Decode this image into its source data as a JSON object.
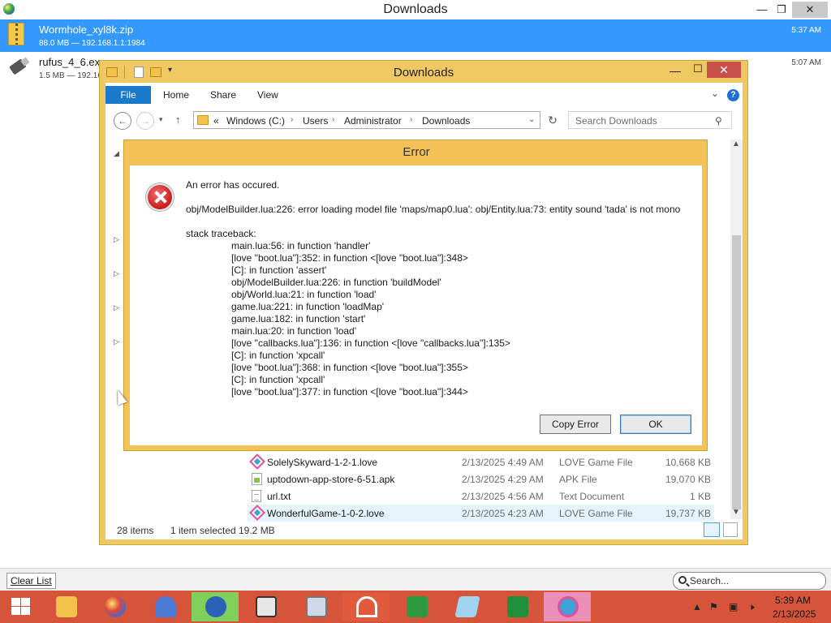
{
  "downloads_window": {
    "title": "Downloads",
    "minimize": "—",
    "maximize": "❐",
    "close": "✕",
    "items": [
      {
        "name": "Wormhole_xyl8k.zip",
        "meta": "88.0 MB — 192.168.1.1:1984",
        "time": "5:37 AM",
        "icon": "zip-folder-icon",
        "selected": true
      },
      {
        "name": "rufus_4_6.exe",
        "meta": "1.5 MB — 192.16",
        "time": "5:07 AM",
        "icon": "usb-drive-icon",
        "selected": false
      }
    ],
    "clear_list": "Clear List",
    "search_placeholder": "Search..."
  },
  "explorer": {
    "title": "Downloads",
    "ribbon": {
      "file": "File",
      "tabs": [
        "Home",
        "Share",
        "View"
      ],
      "help": "?"
    },
    "address": {
      "prefix": "«",
      "crumbs": [
        "Windows (C:)",
        "Users",
        "Administrator",
        "Downloads"
      ]
    },
    "search_placeholder": "Search Downloads",
    "files": [
      {
        "name": "SolelySkyward-1-2-1.love",
        "date": "2/13/2025 4:49 AM",
        "type": "LOVE Game File",
        "size": "10,668 KB",
        "icon": "love-file-icon"
      },
      {
        "name": "uptodown-app-store-6-51.apk",
        "date": "2/13/2025 4:29 AM",
        "type": "APK File",
        "size": "19,070 KB",
        "icon": "apk-file-icon"
      },
      {
        "name": "url.txt",
        "date": "2/13/2025 4:56 AM",
        "type": "Text Document",
        "size": "1 KB",
        "icon": "text-file-icon"
      },
      {
        "name": "WonderfulGame-1-0-2.love",
        "date": "2/13/2025 4:23 AM",
        "type": "LOVE Game File",
        "size": "19,737 KB",
        "icon": "love-file-icon"
      }
    ],
    "status": {
      "count": "28 items",
      "selected": "1 item selected",
      "size": "19.2 MB"
    }
  },
  "error_dialog": {
    "title": "Error",
    "heading": "An error has occured.",
    "message": "obj/ModelBuilder.lua:226: error loading model file 'maps/map0.lua': obj/Entity.lua:73: entity sound 'tada' is not mono",
    "traceback_label": "stack traceback:",
    "traceback": [
      "main.lua:56: in function 'handler'",
      "[love \"boot.lua\"]:352: in function <[love \"boot.lua\"]:348>",
      "[C]: in function 'assert'",
      "obj/ModelBuilder.lua:226: in function 'buildModel'",
      "obj/World.lua:21: in function 'load'",
      "game.lua:221: in function 'loadMap'",
      "game.lua:182: in function 'start'",
      "main.lua:20: in function 'load'",
      "[love \"callbacks.lua\"]:136: in function <[love \"callbacks.lua\"]:135>",
      "[C]: in function 'xpcall'",
      "[love \"boot.lua\"]:368: in function <[love \"boot.lua\"]:355>",
      "[C]: in function 'xpcall'",
      "[love \"boot.lua\"]:377: in function <[love \"boot.lua\"]:344>"
    ],
    "copy_button": "Copy Error",
    "ok_button": "OK"
  },
  "taskbar": {
    "apps": [
      "file-explorer-icon",
      "firefox-globe-icon",
      "bird-app-icon",
      "monster-app-icon",
      "remote-desktop-icon",
      "monitor-app-icon",
      "music-app-icon",
      "store-icon",
      "notepad-icon",
      "xbox-icon",
      "love-app-icon"
    ],
    "clock_time": "5:39 AM",
    "clock_date": "2/13/2025"
  },
  "colors": {
    "accent": "#3399ff",
    "dialog_frame": "#f3c155",
    "taskbar": "#d6553a",
    "file_tab": "#1979ca"
  }
}
